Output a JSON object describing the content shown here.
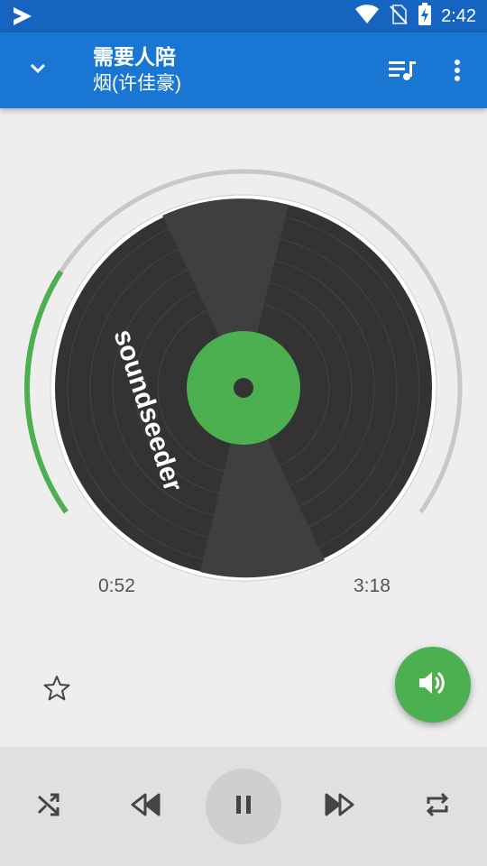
{
  "status_bar": {
    "time": "2:42",
    "icons": [
      "play-store-icon",
      "wifi-icon",
      "no-sim-icon",
      "battery-charging-icon"
    ]
  },
  "toolbar": {
    "song_title": "需要人陪",
    "artist": "烟(许佳豪)",
    "icons": [
      "chevron-down-icon",
      "queue-music-icon",
      "more-vert-icon"
    ]
  },
  "player": {
    "disc_brand": "soundseeder",
    "elapsed": "0:52",
    "duration": "3:18",
    "progress_fraction": 0.27
  },
  "actions": {
    "icons": [
      "star-outline-icon",
      "volume-icon"
    ]
  },
  "controls": {
    "icons": [
      "shuffle-icon",
      "previous-icon",
      "pause-icon",
      "next-icon",
      "repeat-icon"
    ]
  },
  "colors": {
    "status_bar": "#1565c0",
    "toolbar": "#1976d2",
    "accent": "#4caf50",
    "disc": "#333333",
    "background": "#eeeeee"
  }
}
